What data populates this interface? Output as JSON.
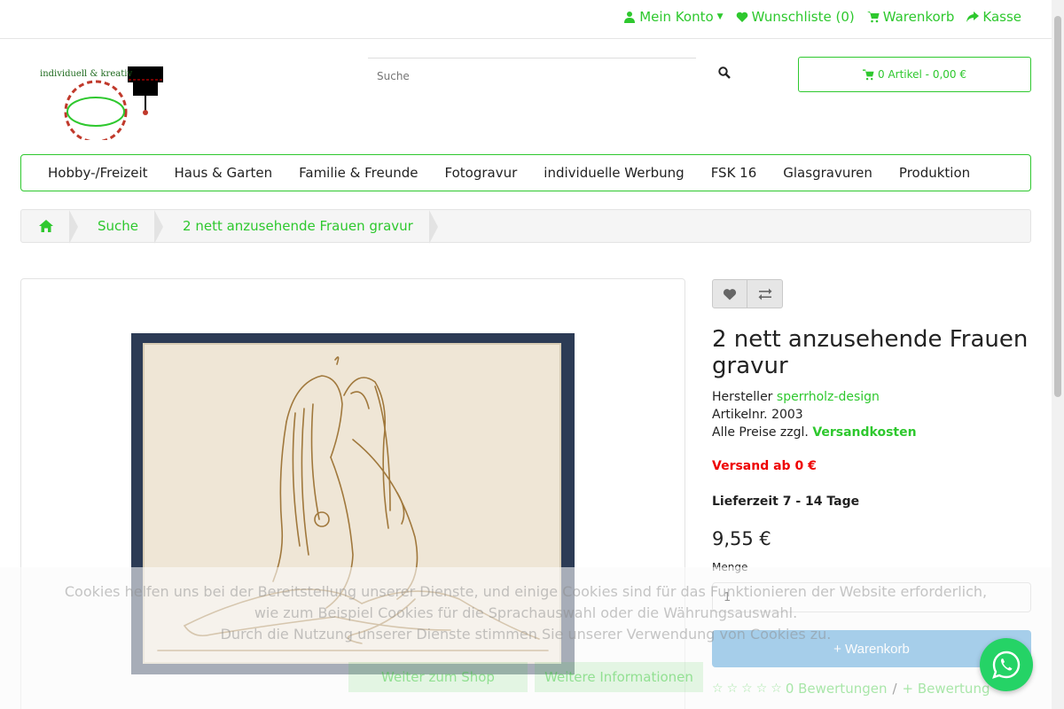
{
  "top": {
    "account": "Mein Konto",
    "wishlist": "Wunschliste (0)",
    "cart": "Warenkorb",
    "checkout": "Kasse"
  },
  "logo": {
    "text": "individuell & kreativ"
  },
  "search": {
    "placeholder": "Suche"
  },
  "header_cart": {
    "label": "0 Artikel - 0,00 €"
  },
  "nav": [
    "Hobby-/Freizeit",
    "Haus & Garten",
    "Familie & Freunde",
    "Fotogravur",
    "individuelle Werbung",
    "FSK 16",
    "Glasgravuren",
    "Produktion"
  ],
  "breadcrumb": {
    "search": "Suche",
    "current": "2 nett anzusehende Frauen gravur"
  },
  "product": {
    "title": "2 nett anzusehende Frauen gravur",
    "manufacturer_label": "Hersteller",
    "manufacturer": "sperrholz-design",
    "article_label": "Artikelnr.",
    "article_no": "2003",
    "prices_note": "Alle Preise zzgl.",
    "shipping_link": "Versandkosten",
    "shipping_free": "Versand ab 0 €",
    "delivery": "Lieferzeit 7 - 14 Tage",
    "price": "9,55 €",
    "qty_label": "Menge",
    "qty_value": "1",
    "add_to_cart": "+ Warenkorb",
    "reviews": "0 Bewertungen",
    "add_review": "+ Bewertung"
  },
  "cookie": {
    "line1": "Cookies helfen uns bei der Bereitstellung unserer Dienste, und einige Cookies sind für das Funktionieren der Website erforderlich,",
    "line2": "wie zum Beispiel Cookies für die Sprachauswahl oder die Währungsauswahl.",
    "line3": "Durch die Nutzung unserer Dienste stimmen Sie unserer Verwendung von Cookies zu.",
    "continue": "Weiter zum Shop",
    "more": "Weitere Informationen"
  },
  "colors": {
    "accent": "#2ec82e",
    "button_blue": "#2a8dd2",
    "shipping_red": "#e00000",
    "whatsapp": "#25d366"
  },
  "icons": [
    "user-icon",
    "heart-icon",
    "shopping-cart-icon",
    "share-icon",
    "search-icon",
    "home-icon",
    "exchange-icon",
    "star-icon",
    "whatsapp-icon"
  ]
}
